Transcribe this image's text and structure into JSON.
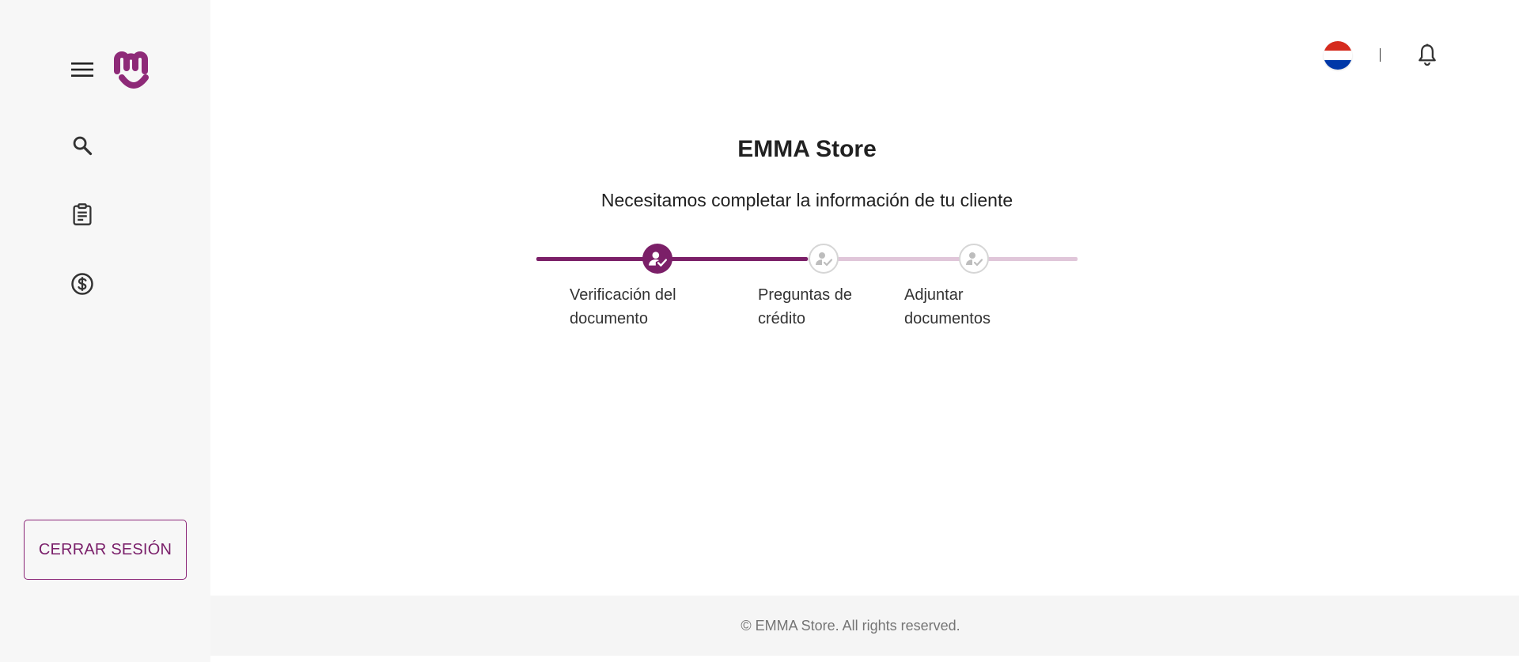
{
  "brand": {
    "logo_icon": "emma-logo-icon",
    "accent_color": "#7b1f68",
    "accent_light": "#e0c6d9"
  },
  "sidebar": {
    "menu_icon": "hamburger-menu-icon",
    "items": [
      {
        "icon": "search-icon"
      },
      {
        "icon": "clipboard-icon"
      },
      {
        "icon": "dollar-icon"
      }
    ],
    "logout_label": "CERRAR SESIÓN"
  },
  "header": {
    "flag_icon": "paraguay-flag-icon",
    "notification_icon": "bell-icon"
  },
  "main": {
    "title": "EMMA Store",
    "subtitle": "Necesitamos completar la información de tu cliente",
    "steps": [
      {
        "label_line1": "Verificación del",
        "label_line2": "documento",
        "state": "active"
      },
      {
        "label_line1": "Preguntas de",
        "label_line2": "crédito",
        "state": "pending"
      },
      {
        "label_line1": "Adjuntar",
        "label_line2": "documentos",
        "state": "pending"
      }
    ]
  },
  "footer": {
    "text": "© EMMA Store. All rights reserved."
  }
}
